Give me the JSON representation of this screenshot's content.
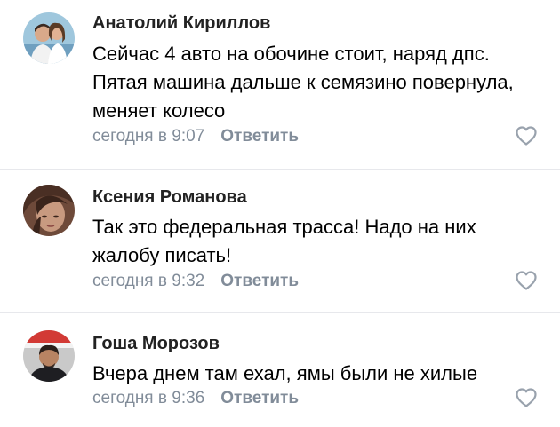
{
  "comments": [
    {
      "author": "Анатолий Кириллов",
      "text": "Сейчас 4 авто на обочине стоит, наряд дпс. Пятая машина дальше к семязино повернула, меняет колесо",
      "time": "сегодня в 9:07",
      "reply_label": "Ответить",
      "avatar_icon": "couple-photo-avatar",
      "like_icon": "heart-outline-icon"
    },
    {
      "author": "Ксения Романова",
      "text": "Так это федеральная трасса! Надо на них жалобу писать!",
      "time": "сегодня в 9:32",
      "reply_label": "Ответить",
      "avatar_icon": "woman-photo-avatar",
      "like_icon": "heart-outline-icon"
    },
    {
      "author": "Гоша Морозов",
      "text": "Вчера днем там ехал, ямы были не хилые",
      "time": "сегодня в 9:36",
      "reply_label": "Ответить",
      "avatar_icon": "man-photo-avatar",
      "like_icon": "heart-outline-icon"
    }
  ],
  "colors": {
    "meta_text": "#818c99",
    "author_text": "#222222",
    "like_outline": "#99a2ad"
  }
}
